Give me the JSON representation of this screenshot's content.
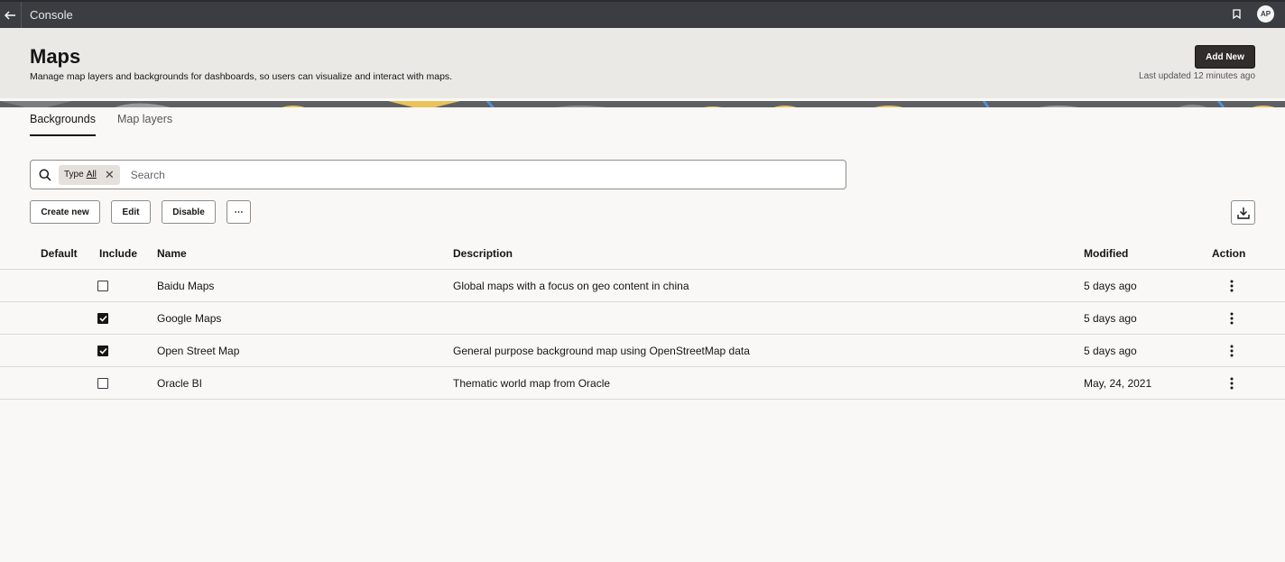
{
  "topbar": {
    "title": "Console",
    "avatar_initials": "AP",
    "back_icon": "arrow-left-icon",
    "bookmark_icon": "bookmark-icon"
  },
  "header": {
    "title": "Maps",
    "subtitle": "Manage map layers and backgrounds for dashboards, so users can visualize and interact with maps.",
    "add_new_label": "Add New",
    "last_updated": "Last updated 12 minutes ago"
  },
  "tabs": [
    {
      "label": "Backgrounds",
      "active": true
    },
    {
      "label": "Map layers",
      "active": false
    }
  ],
  "search": {
    "filter_chip": {
      "label": "Type",
      "value": "All"
    },
    "placeholder": "Search"
  },
  "toolbar": {
    "create_label": "Create new",
    "edit_label": "Edit",
    "disable_label": "Disable",
    "more_label": "⋯"
  },
  "table": {
    "headers": {
      "default": "Default",
      "include": "Include",
      "name": "Name",
      "description": "Description",
      "modified": "Modified",
      "action": "Action"
    },
    "rows": [
      {
        "include": false,
        "name": "Baidu Maps",
        "description": "Global maps with a focus on geo content in china",
        "modified": "5 days ago"
      },
      {
        "include": true,
        "name": "Google Maps",
        "description": "",
        "modified": "5 days ago"
      },
      {
        "include": true,
        "name": "Open Street Map",
        "description": "General purpose background map using OpenStreetMap data",
        "modified": "5 days ago"
      },
      {
        "include": false,
        "name": "Oracle BI",
        "description": "Thematic world map from Oracle",
        "modified": "May, 24, 2021"
      }
    ]
  },
  "colors": {
    "topbar": "#3b3d42",
    "header": "#ebe9e6",
    "primary_button": "#312d2a",
    "banner_yellow": "#e8c35a",
    "banner_blue": "#4f8fd9"
  }
}
